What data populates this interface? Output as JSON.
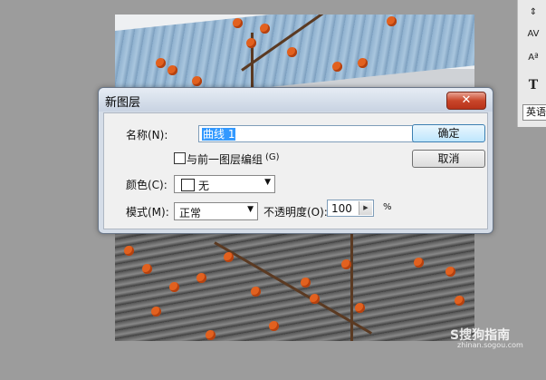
{
  "dialog": {
    "title": "新图层",
    "close_glyph": "✕",
    "name_label": "名称(N):",
    "name_value": "曲线 1",
    "group_label": "与前一图层编组",
    "group_shortcut": "(G)",
    "color_label": "颜色(C):",
    "color_value": "无",
    "mode_label": "模式(M):",
    "mode_value": "正常",
    "opacity_label": "不透明度(O):",
    "opacity_value": "100",
    "opacity_unit": "%",
    "ok_label": "确定",
    "cancel_label": "取消"
  },
  "toolbar": {
    "icons": [
      "align-icon",
      "tracking-icon",
      "baseline-icon",
      "text-icon"
    ],
    "tracking_text": "AV",
    "baseline_text": "Aª",
    "text_glyph": "T",
    "lang_value": "英语"
  },
  "watermark": {
    "text": "S搜狗指南",
    "sub": "zhinan.sogou.com"
  },
  "colors": {
    "accent": "#3399ff",
    "close": "#c9462a",
    "dialog_frame": "#d5dde8"
  }
}
